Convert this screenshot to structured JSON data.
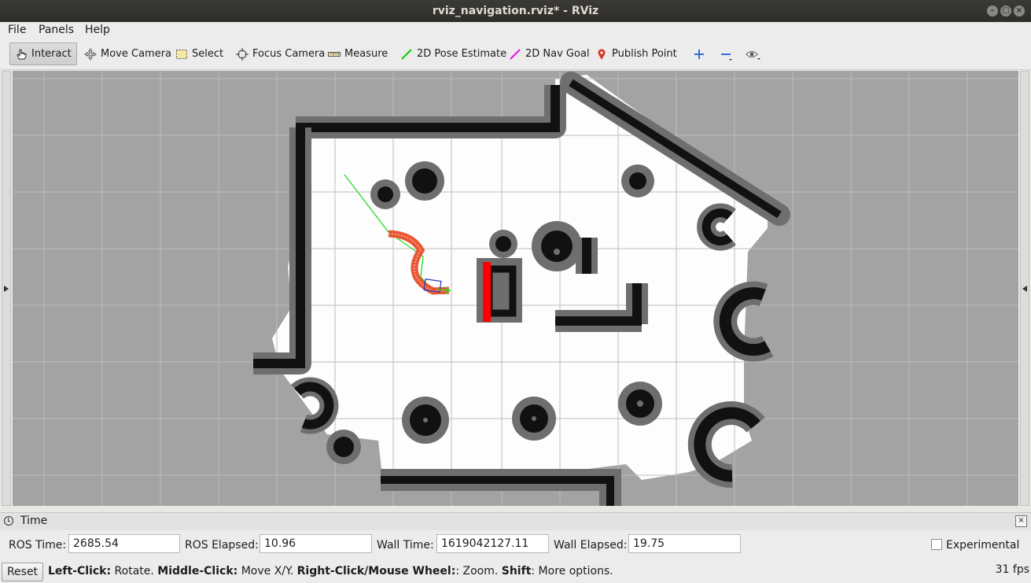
{
  "window": {
    "title": "rviz_navigation.rviz* - RViz",
    "controls": [
      "–",
      "□",
      "×"
    ]
  },
  "menubar": {
    "file": "File",
    "panels": "Panels",
    "help": "Help"
  },
  "toolbar": {
    "interact": "Interact",
    "move_camera": "Move Camera",
    "select": "Select",
    "focus_camera": "Focus Camera",
    "measure": "Measure",
    "pose_estimate": "2D Pose Estimate",
    "nav_goal": "2D Nav Goal",
    "publish_point": "Publish Point",
    "colors": {
      "pose_estimate": "#11cc11",
      "nav_goal": "#e619e6",
      "publish_point": "#d43a2a",
      "add": "#2d6fd6"
    }
  },
  "time_panel": {
    "title": "Time",
    "ros_time_label": "ROS Time:",
    "ros_time": "2685.54",
    "ros_elapsed_label": "ROS Elapsed:",
    "ros_elapsed": "10.96",
    "wall_time_label": "Wall Time:",
    "wall_time": "1619042127.11",
    "wall_elapsed_label": "Wall Elapsed:",
    "wall_elapsed": "19.75",
    "experimental_label": "Experimental"
  },
  "status": {
    "reset": "Reset",
    "hint_left_click": "Left-Click:",
    "hint_rotate": " Rotate. ",
    "hint_middle_click": "Middle-Click:",
    "hint_move": " Move X/Y. ",
    "hint_right_click": "Right-Click/Mouse Wheel:",
    "hint_zoom": ": Zoom. ",
    "hint_shift": "Shift",
    "hint_more": ": More options.",
    "fps": "31 fps"
  },
  "map": {
    "colors": {
      "unknown": "#a3a3a3",
      "free": "#fdfdfd",
      "inflation": "#6e6e6e",
      "obstacle": "#111111",
      "grid": "#bdbdbd",
      "global_plan": "#22dd22",
      "local_plan": "#e8421c",
      "footprint": "#2233cc",
      "laser": "#ff0000"
    }
  }
}
